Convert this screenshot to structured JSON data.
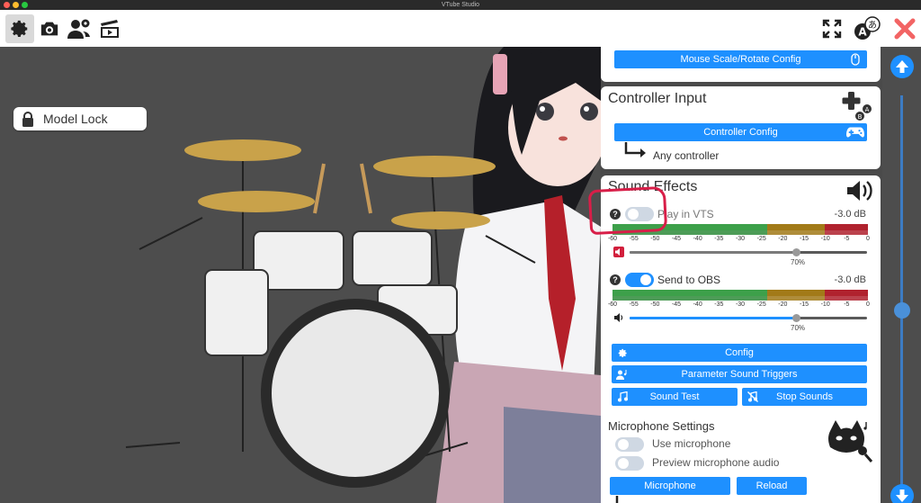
{
  "window": {
    "title": "VTube Studio"
  },
  "colors": {
    "accent": "#1e90ff",
    "annotation": "#d81e48",
    "meter_green": "#2e8b3a",
    "meter_yellow": "#a27a18",
    "meter_red": "#b0222e"
  },
  "toolbar": {
    "left_icons": [
      "gear-icon",
      "camera-icon",
      "users-settings-icon",
      "clapperboard-icon"
    ],
    "right_icons": [
      "fullscreen-icon",
      "language-icon",
      "close-icon"
    ]
  },
  "model_lock": {
    "label": "Model Lock"
  },
  "panel": {
    "mouse_scale_button": "Mouse Scale/Rotate Config",
    "controller_input": {
      "title": "Controller Input",
      "config_button": "Controller Config",
      "device": "Any controller"
    },
    "sound_effects": {
      "title": "Sound Effects",
      "play_in_vts": {
        "label": "Play in VTS",
        "enabled": false,
        "db": "-3.0 dB",
        "volume_pct": "70%",
        "volume": 0.7
      },
      "send_to_obs": {
        "label": "Send to OBS",
        "enabled": true,
        "db": "-3.0 dB",
        "volume_pct": "70%",
        "volume": 0.7
      },
      "scale": [
        "-60",
        "-55",
        "-50",
        "-45",
        "-40",
        "-35",
        "-30",
        "-25",
        "-20",
        "-15",
        "-10",
        "-5",
        "0"
      ],
      "config_button": "Config",
      "param_triggers_button": "Parameter Sound Triggers",
      "sound_test_button": "Sound Test",
      "stop_sounds_button": "Stop Sounds"
    },
    "microphone": {
      "title": "Microphone Settings",
      "use_mic": {
        "label": "Use microphone",
        "enabled": false
      },
      "preview_audio": {
        "label": "Preview microphone audio",
        "enabled": false
      },
      "mic_button": "Microphone",
      "reload_button": "Reload"
    }
  }
}
